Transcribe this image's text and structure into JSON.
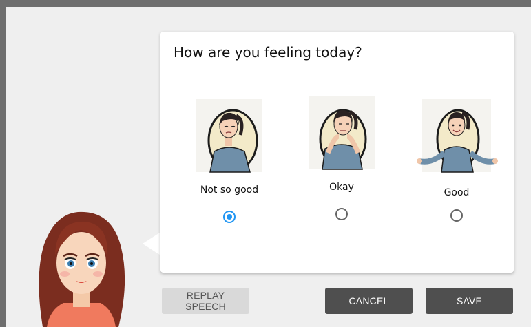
{
  "dialog": {
    "question": "How are you feeling today?",
    "options": [
      {
        "label": "Not so good",
        "selected": true,
        "icon": "sad-woman-illustration"
      },
      {
        "label": "Okay",
        "selected": false,
        "icon": "neutral-woman-illustration"
      },
      {
        "label": "Good",
        "selected": false,
        "icon": "happy-woman-illustration"
      }
    ]
  },
  "buttons": {
    "replay": "REPLAY SPEECH",
    "cancel": "CANCEL",
    "save": "SAVE"
  },
  "colors": {
    "accent": "#2196f3",
    "button_dark": "#4f4f4f",
    "button_light": "#d9d9d9"
  }
}
